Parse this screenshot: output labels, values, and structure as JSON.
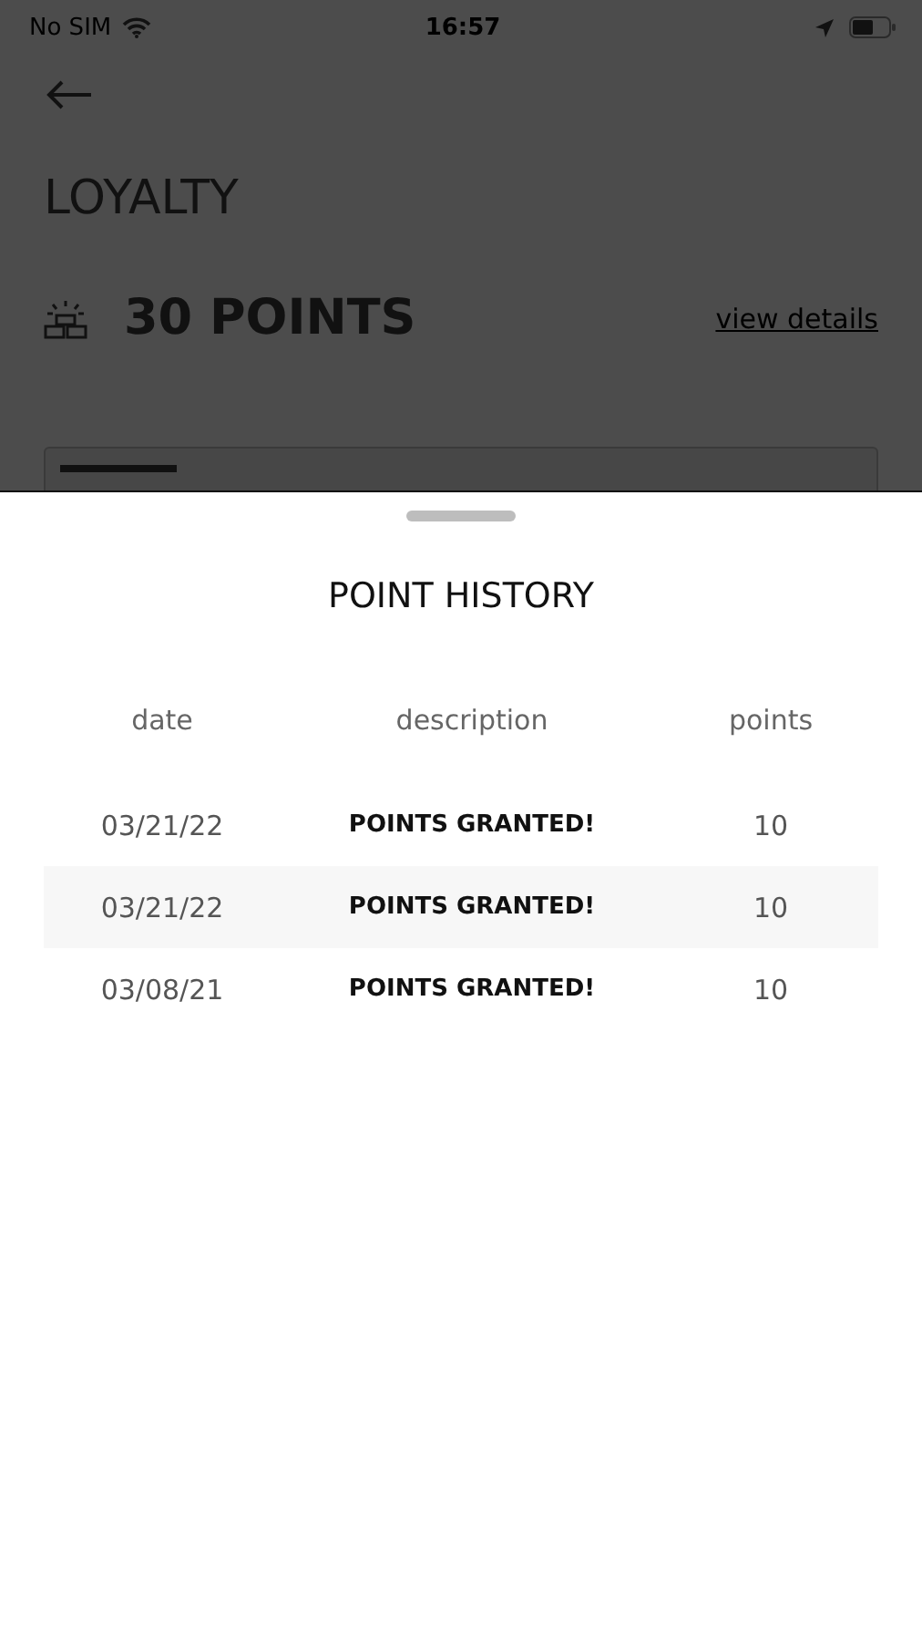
{
  "status_bar": {
    "carrier": "No SIM",
    "time": "16:57"
  },
  "page": {
    "title": "LOYALTY",
    "points": "30 POINTS",
    "details_link": "view details"
  },
  "sheet": {
    "title": "POINT HISTORY",
    "columns": [
      "date",
      "description",
      "points"
    ],
    "rows": [
      {
        "date": "03/21/22",
        "description": "POINTS GRANTED!",
        "points": "10"
      },
      {
        "date": "03/21/22",
        "description": "POINTS GRANTED!",
        "points": "10"
      },
      {
        "date": "03/08/21",
        "description": "POINTS GRANTED!",
        "points": "10"
      }
    ]
  }
}
